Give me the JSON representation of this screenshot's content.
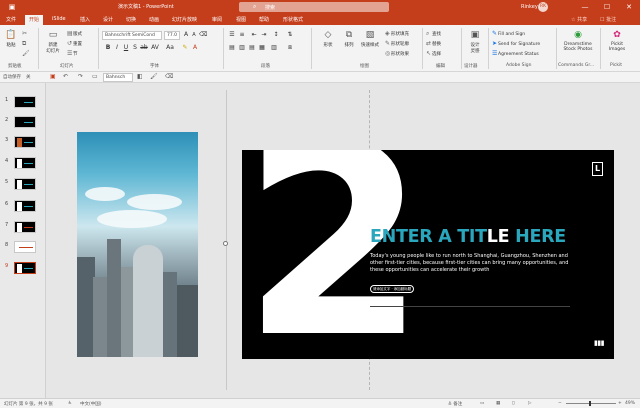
{
  "titlebar": {
    "app_title": "演示文稿1 - PowerPoint",
    "search_placeholder": "搜索",
    "user_name": "Rinkey 滑",
    "user_initials": "RK",
    "minimize": "—",
    "maximize": "☐",
    "close": "✕"
  },
  "tabs": {
    "items": [
      "文件",
      "开始",
      "iSlide",
      "插入",
      "设计",
      "切换",
      "动画",
      "幻灯片放映",
      "审阅",
      "视图",
      "帮助",
      "形状格式"
    ],
    "share": "☆ 共享",
    "comment": "☐ 批注"
  },
  "ribbon": {
    "paste_label": "粘贴",
    "clipboard_group": "剪贴板",
    "new_slide_label": "新建\n幻灯片",
    "layout_label": "版式",
    "reset_label": "重置",
    "section_label": "节",
    "slides_group": "幻灯片",
    "font_name": "Bahnschrift SemiCond",
    "font_size": "77.0",
    "font_group": "字体",
    "paragraph_group": "段落",
    "shape_label": "形状",
    "arrange_label": "排列",
    "quick_styles_label": "快速样式",
    "shape_fill": "形状填充",
    "shape_outline": "形状轮廓",
    "shape_effects": "形状效果",
    "drawing_group": "绘图",
    "find_label": "查找",
    "replace_label": "替换",
    "select_label": "选择",
    "editing_group": "编辑",
    "design_ideas_label": "设计\n灵感",
    "designer_group": "设计器",
    "fill_sign": "Fill and Sign",
    "send_signature": "Send for Signature",
    "agreement_status": "Agreement Status",
    "adobe_group": "Adobe Sign",
    "dreamstime_label": "Dreamstime\nStock Photos",
    "commands_group": "Commands Gr...",
    "pickit_label": "Pickit\nImages",
    "pickit_group": "Pickit"
  },
  "qat": {
    "autosave_label": "自动保存",
    "autosave_state": "关",
    "font_name": "Bahnsch"
  },
  "thumbnails": [
    {
      "num": "1"
    },
    {
      "num": "2"
    },
    {
      "num": "3"
    },
    {
      "num": "4"
    },
    {
      "num": "5"
    },
    {
      "num": "6"
    },
    {
      "num": "7"
    },
    {
      "num": "8"
    },
    {
      "num": "9"
    }
  ],
  "slide": {
    "big_number": "2",
    "headline_a": "ENTER A TITLE HE",
    "headline_b": "",
    "headline_lt_a": "ENTER A TIT",
    "headline_lt_mid": "LE",
    "headline_lt_b": " HERE",
    "body_text": "Today's young people like to run north to Shanghai, Guangzhou, Shenzhen and other first-tier cities, because first-tier cities can bring many opportunities, and these opportunities can accelerate their growth",
    "pill_text": "请添加文字 · 添加副标题",
    "logo_letter": "L",
    "page_icon": "▮▮▮"
  },
  "statusbar": {
    "slide_info": "幻灯片 第 9 张，共 9 张",
    "language": "中文(中国)",
    "notes": "≜ 备注",
    "zoom_minus": "−",
    "zoom_plus": "+",
    "zoom_value": "49%"
  },
  "colors": {
    "accent": "#c43e1c",
    "headline_teal": "#2aa6bd",
    "slide_bg": "#000000"
  }
}
